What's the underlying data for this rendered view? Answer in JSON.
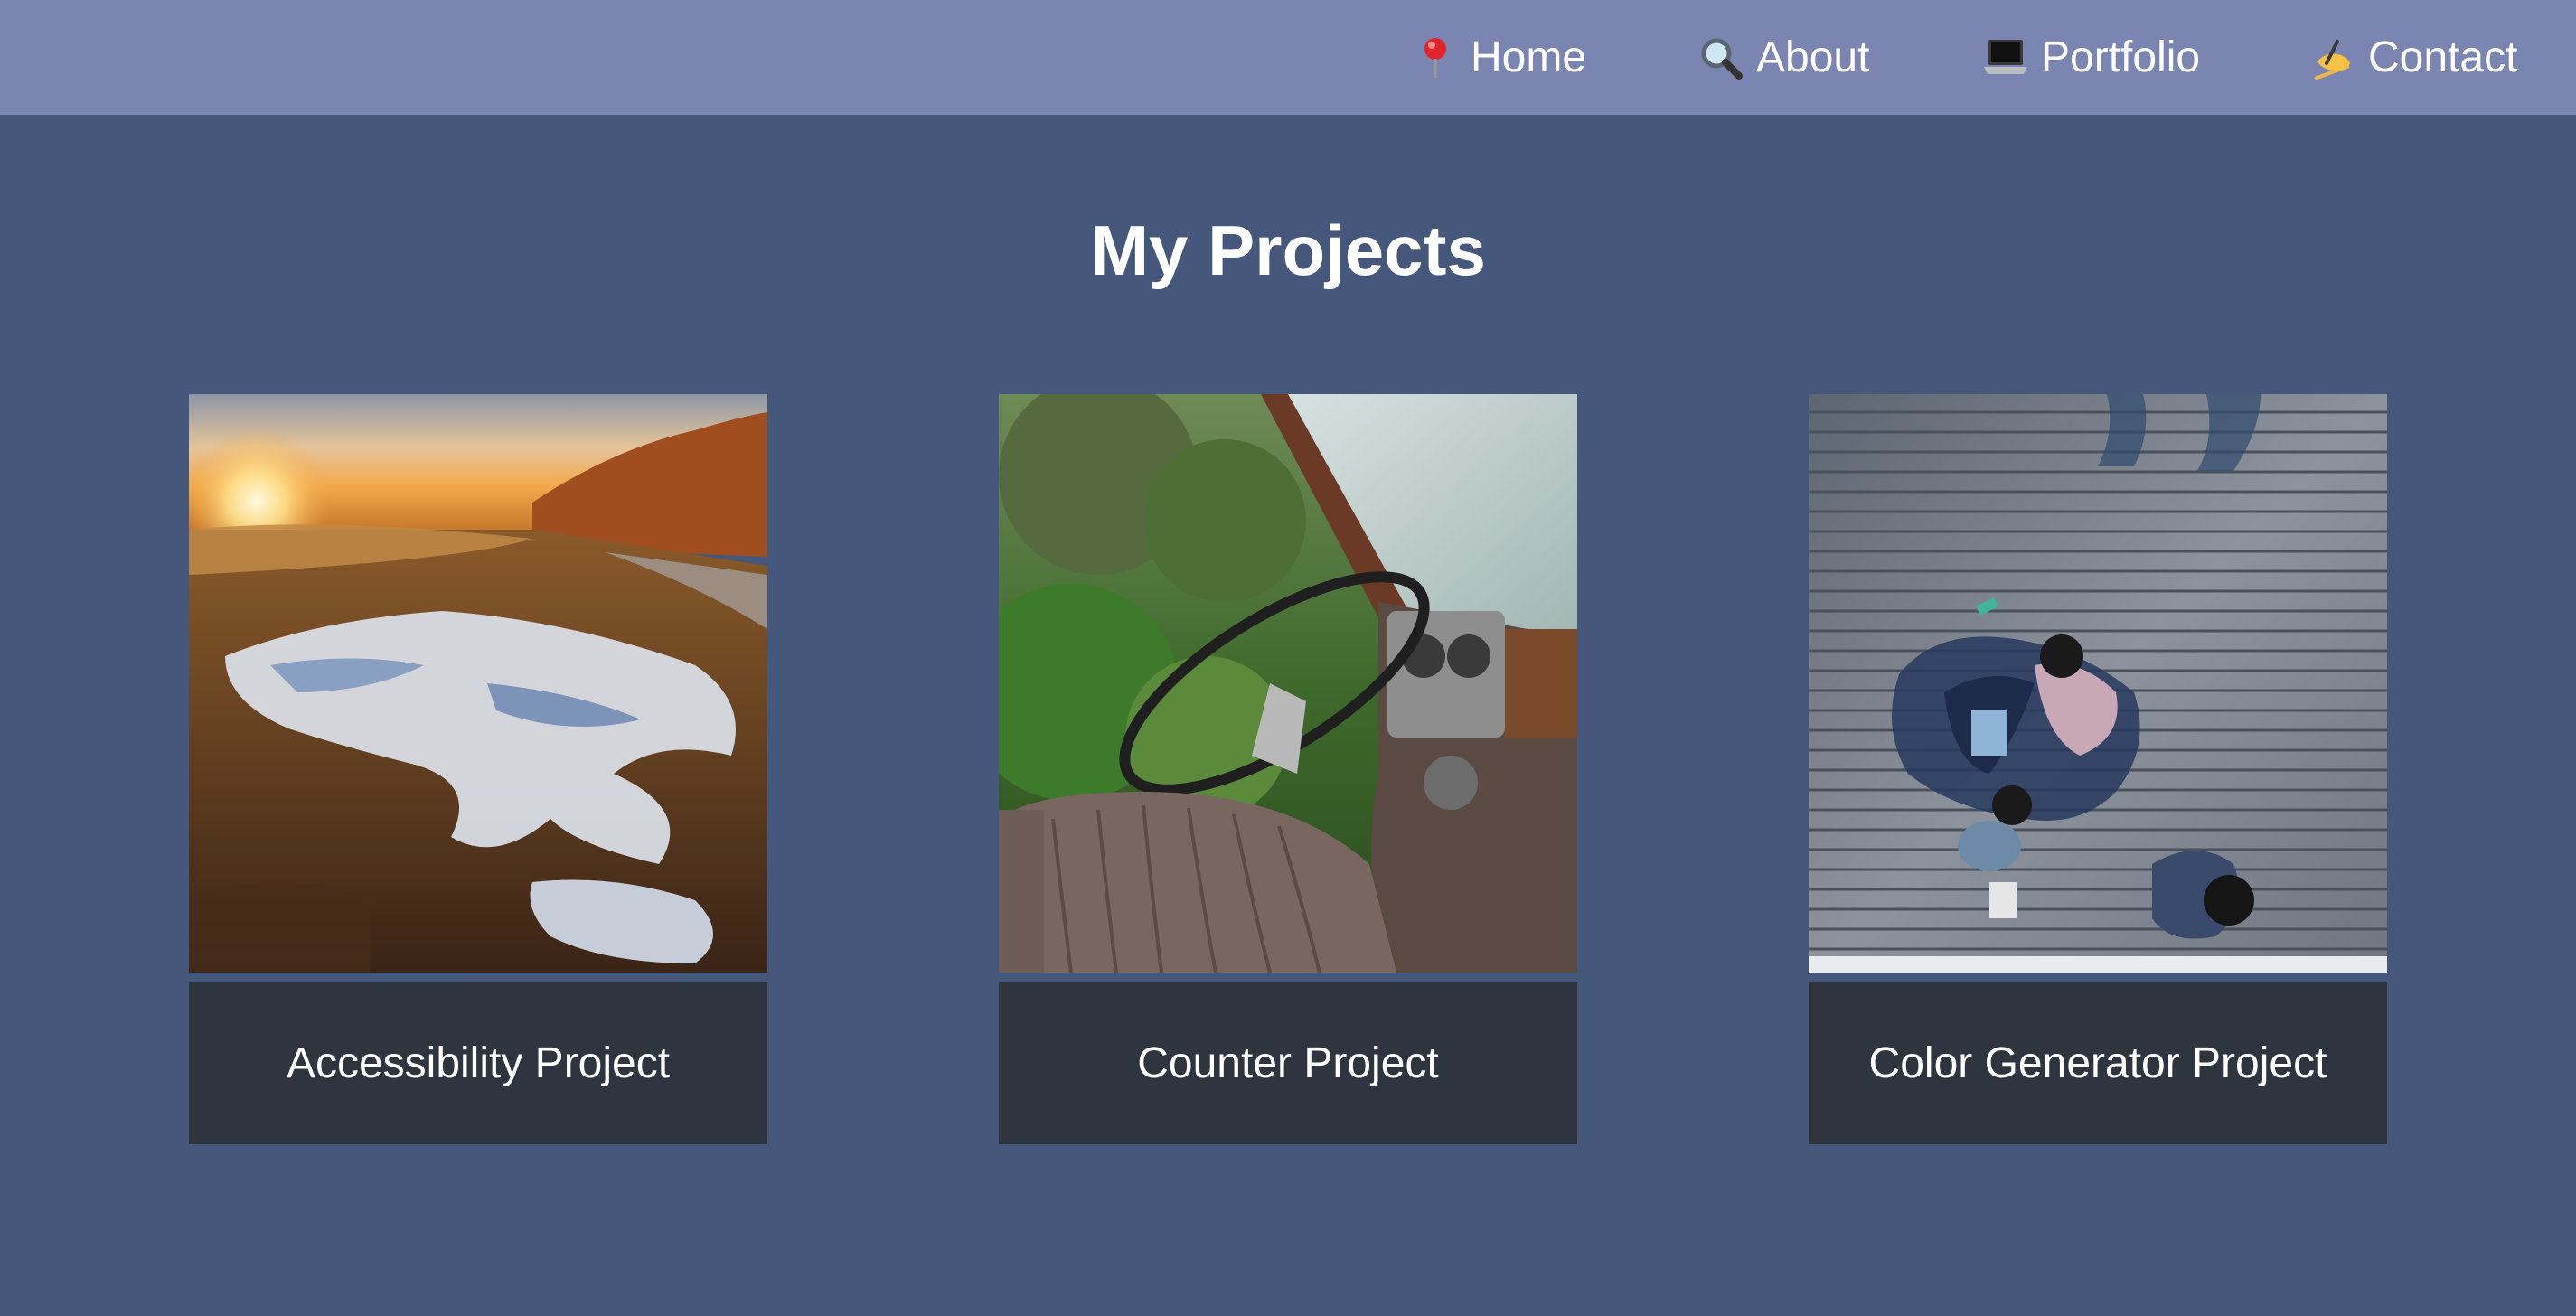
{
  "nav": {
    "items": [
      {
        "label": "Home",
        "icon": "pin-icon"
      },
      {
        "label": "About",
        "icon": "magnifier-icon"
      },
      {
        "label": "Portfolio",
        "icon": "laptop-icon"
      },
      {
        "label": "Contact",
        "icon": "writing-hand-icon"
      }
    ]
  },
  "main": {
    "title": "My Projects",
    "projects": [
      {
        "label": "Accessibility Project",
        "image": "sunset-puddle-road-photo"
      },
      {
        "label": "Counter Project",
        "image": "abandoned-truck-interior-photo"
      },
      {
        "label": "Color Generator Project",
        "image": "people-on-boardwalk-photo"
      }
    ]
  },
  "colors": {
    "background": "#45577b",
    "navbar": "#7b85b1",
    "caption": "#2e353f",
    "text": "#ffffff"
  }
}
